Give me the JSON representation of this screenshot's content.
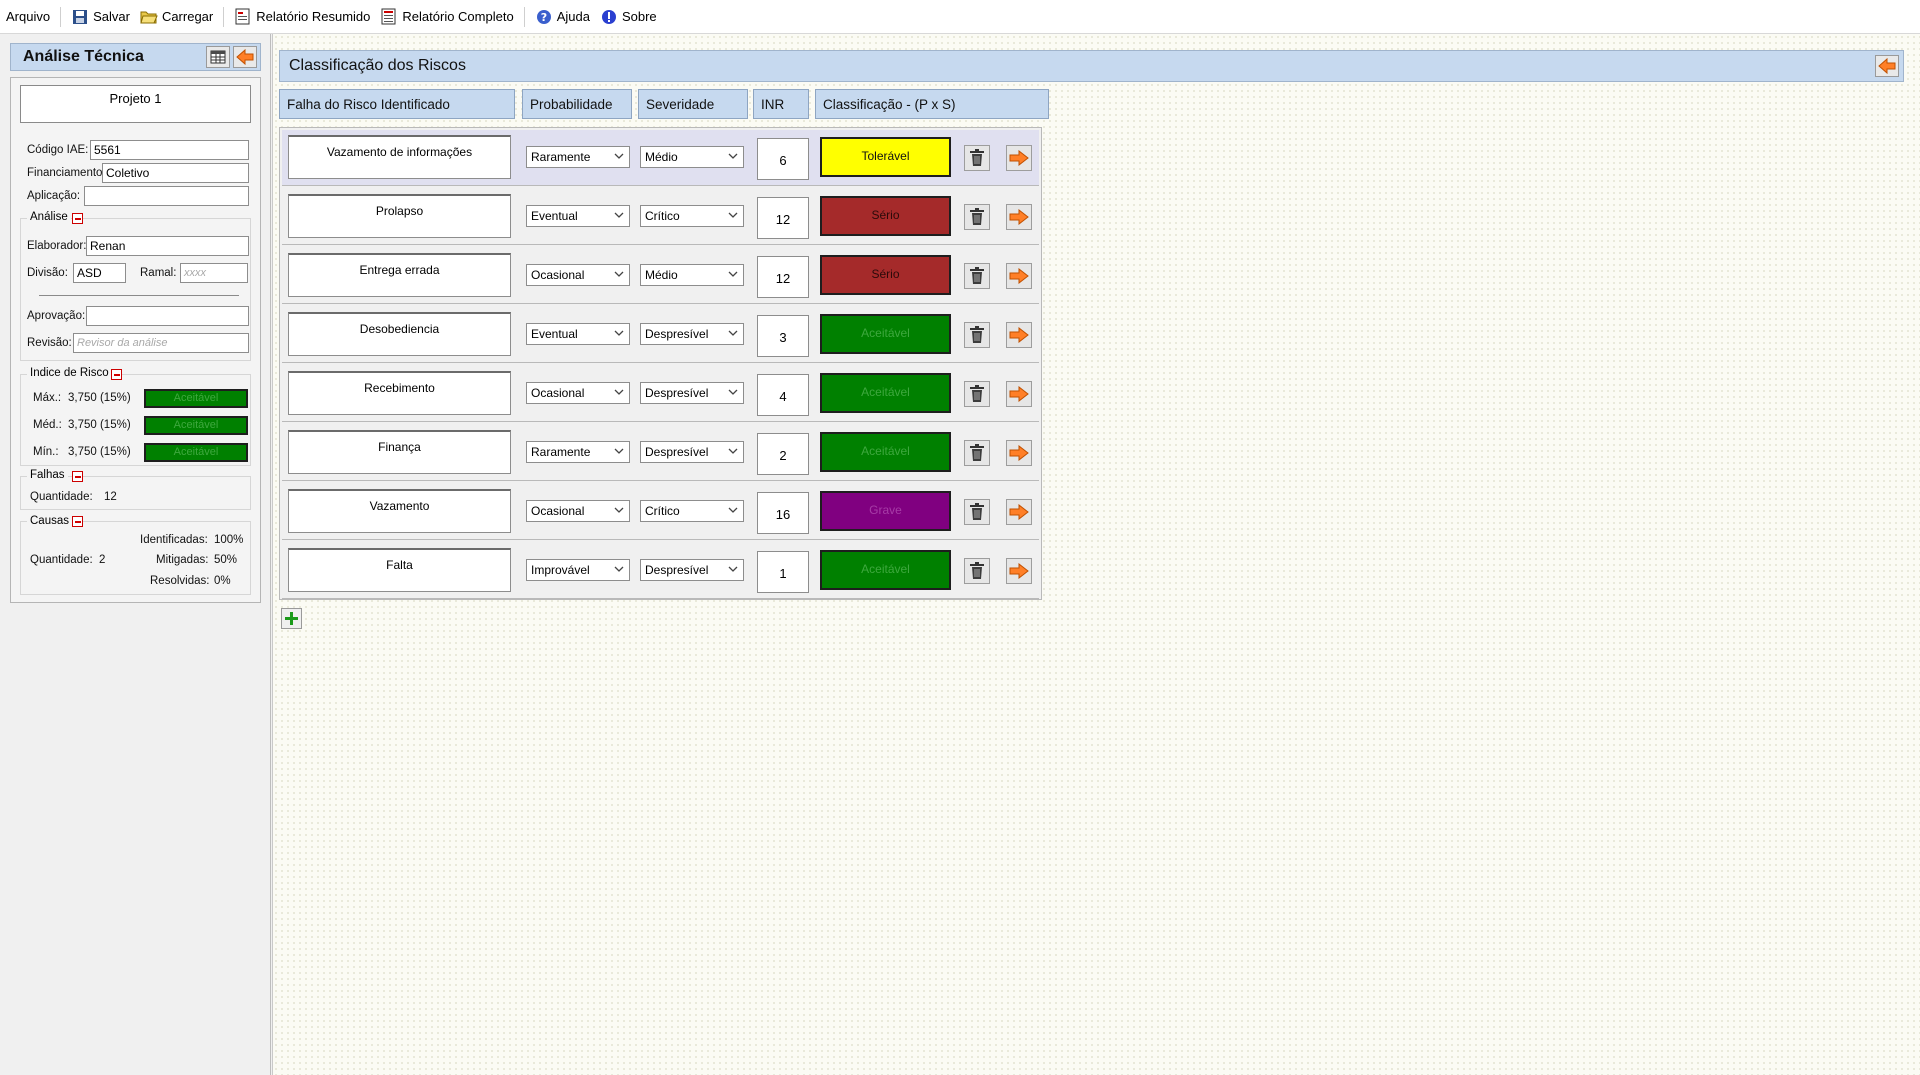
{
  "menu": {
    "arquivo": "Arquivo",
    "salvar": "Salvar",
    "carregar": "Carregar",
    "relatorio_resumido": "Relatório Resumido",
    "relatorio_completo": "Relatório Completo",
    "ajuda": "Ajuda",
    "sobre": "Sobre"
  },
  "left": {
    "title": "Análise Técnica",
    "project": "Projeto 1",
    "codigo_label": "Código IAE:",
    "codigo_value": "5561",
    "financiamento_label": "Financiamento:",
    "financiamento_value": "Coletivo",
    "aplicacao_label": "Aplicação:",
    "aplicacao_value": "",
    "analise_title": "Análise",
    "elaborador_label": "Elaborador:",
    "elaborador_value": "Renan",
    "divisao_label": "Divisão:",
    "divisao_value": "ASD",
    "ramal_label": "Ramal:",
    "ramal_placeholder": "xxxx",
    "aprovacao_label": "Aprovação:",
    "aprovacao_value": "",
    "revisao_label": "Revisão:",
    "revisao_placeholder": "Revisor da análise",
    "indice_title": "Indice de Risco",
    "max_label": "Máx.:",
    "max_value": "3,750 (15%)",
    "med_label": "Méd.:",
    "med_value": "3,750 (15%)",
    "min_label": "Mín.:",
    "min_value": "3,750 (15%)",
    "indice_badge": "Aceitável",
    "falhas_title": "Falhas",
    "quantidade_label": "Quantidade:",
    "falhas_quantidade": "12",
    "causas_title": "Causas",
    "causas_quantidade": "2",
    "identificadas_label": "Identificadas:",
    "identificadas_value": "100%",
    "mitigadas_label": "Mitigadas:",
    "mitigadas_value": "50%",
    "resolvidas_label": "Resolvidas:",
    "resolvidas_value": "0%"
  },
  "main": {
    "title": "Classificação dos Riscos",
    "columns": [
      "Falha do Risco Identificado",
      "Probabilidade",
      "Severidade",
      "INR",
      "Classificação - (P x S)"
    ],
    "rows": [
      {
        "falha": "Vazamento de informações",
        "prob": "Raramente",
        "sev": "Médio",
        "inr": "6",
        "class": "Tolerável",
        "bg": "#ffff00",
        "fg": "#111111"
      },
      {
        "falha": "Prolapso",
        "prob": "Eventual",
        "sev": "Crítico",
        "inr": "12",
        "class": "Sério",
        "bg": "#a52a2a",
        "fg": "#2b0a0a"
      },
      {
        "falha": "Entrega errada",
        "prob": "Ocasional",
        "sev": "Médio",
        "inr": "12",
        "class": "Sério",
        "bg": "#a52a2a",
        "fg": "#2b0a0a"
      },
      {
        "falha": "Desobediencia",
        "prob": "Eventual",
        "sev": "Despresível",
        "inr": "3",
        "class": "Aceitável",
        "bg": "#008000",
        "fg": "#3ea83e"
      },
      {
        "falha": "Recebimento",
        "prob": "Ocasional",
        "sev": "Despresível",
        "inr": "4",
        "class": "Aceitável",
        "bg": "#008000",
        "fg": "#3ea83e"
      },
      {
        "falha": "Finança",
        "prob": "Raramente",
        "sev": "Despresível",
        "inr": "2",
        "class": "Aceitável",
        "bg": "#008000",
        "fg": "#3ea83e"
      },
      {
        "falha": "Vazamento",
        "prob": "Ocasional",
        "sev": "Crítico",
        "inr": "16",
        "class": "Grave",
        "bg": "#800080",
        "fg": "#a63ca6"
      },
      {
        "falha": "Falta",
        "prob": "Improvável",
        "sev": "Despresível",
        "inr": "1",
        "class": "Aceitável",
        "bg": "#008000",
        "fg": "#3ea83e"
      }
    ]
  },
  "colors": {
    "header_blue": "#c6d9ef",
    "accent_orange": "#ff7f27",
    "aceitavel": "#008000"
  }
}
